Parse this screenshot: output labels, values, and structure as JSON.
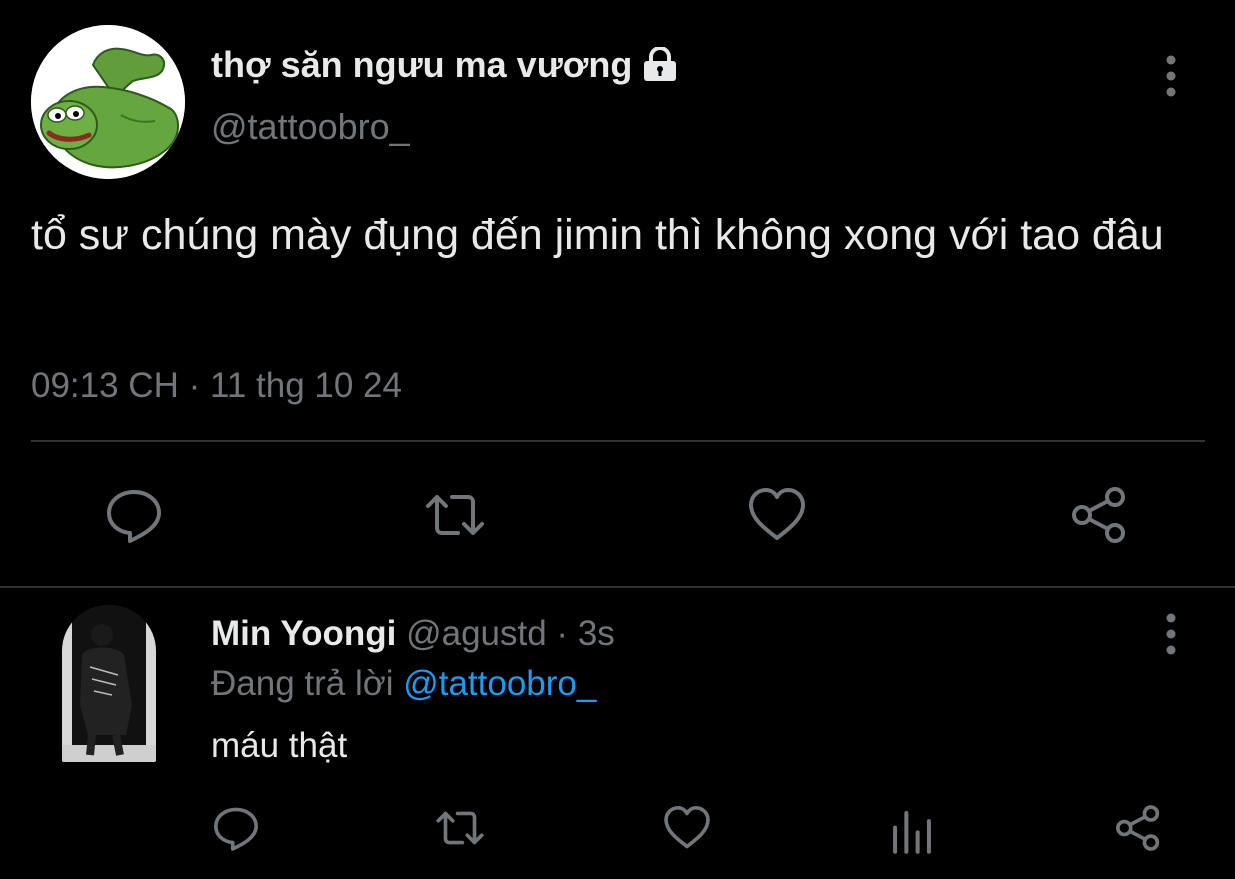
{
  "main_tweet": {
    "display_name": "thợ săn ngưu ma vương",
    "handle": "@tattoobro_",
    "text": "tổ sư chúng mày đụng đến jimin thì không xong với tao đâu",
    "timestamp": "09:13 CH · 11 thg 10 24",
    "icons": {
      "avatar": "pepe-frog-avatar",
      "lock": "lock-icon",
      "more": "more-vertical-icon",
      "actions": [
        "reply-icon",
        "retweet-icon",
        "like-icon",
        "share-icon"
      ]
    }
  },
  "reply": {
    "display_name": "Min Yoongi",
    "handle": "@agustd",
    "separator": " · ",
    "age": "3s",
    "replying_label": "Đang trả lời ",
    "replying_handle": "@tattoobro_",
    "text": "máu thật",
    "icons": {
      "avatar": "person-jacket-avatar",
      "more": "more-vertical-icon",
      "actions": [
        "reply-icon",
        "retweet-icon",
        "like-icon",
        "analytics-icon",
        "share-icon"
      ]
    }
  },
  "colors": {
    "background": "#000000",
    "text_primary": "#e7e9ea",
    "text_secondary": "#71767b",
    "link": "#1d9bf0",
    "divider": "#2f3336"
  }
}
